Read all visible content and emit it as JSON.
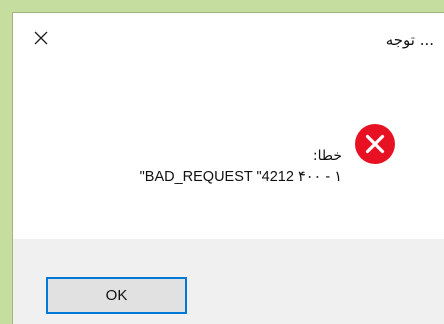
{
  "window": {
    "title": "... توجه",
    "close_icon": "close-icon"
  },
  "message": {
    "label": "خطا:",
    "detail": "\"BAD_REQUEST \"4212 ۴۰۰ - ۱",
    "icon": "error-icon",
    "icon_color": "#e81123"
  },
  "footer": {
    "ok_label": "OK",
    "background": "#f0f0f0"
  },
  "colors": {
    "accent": "#0078d7",
    "desktop": "#c5dd9e"
  }
}
